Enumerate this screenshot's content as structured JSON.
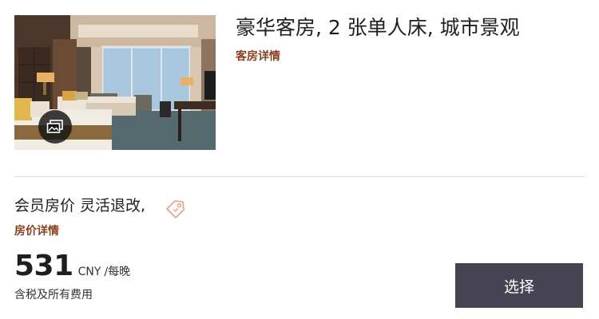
{
  "room": {
    "title": "豪华客房, 2 张单人床, 城市景观",
    "details_link": "客房详情",
    "photo_icon": "gallery-icon"
  },
  "rate": {
    "name": "会员房价 灵活退改,",
    "tag_icon": "price-tag-icon",
    "details_link": "房价详情",
    "amount": "531",
    "currency": "CNY",
    "unit": "/每晚",
    "tax_note": "含税及所有费用"
  },
  "actions": {
    "select_label": "选择"
  },
  "colors": {
    "link": "#8b3f1d",
    "button_bg": "#464452",
    "button_text": "#ffffff",
    "divider": "#dedede",
    "tag_icon": "#e8a084"
  }
}
